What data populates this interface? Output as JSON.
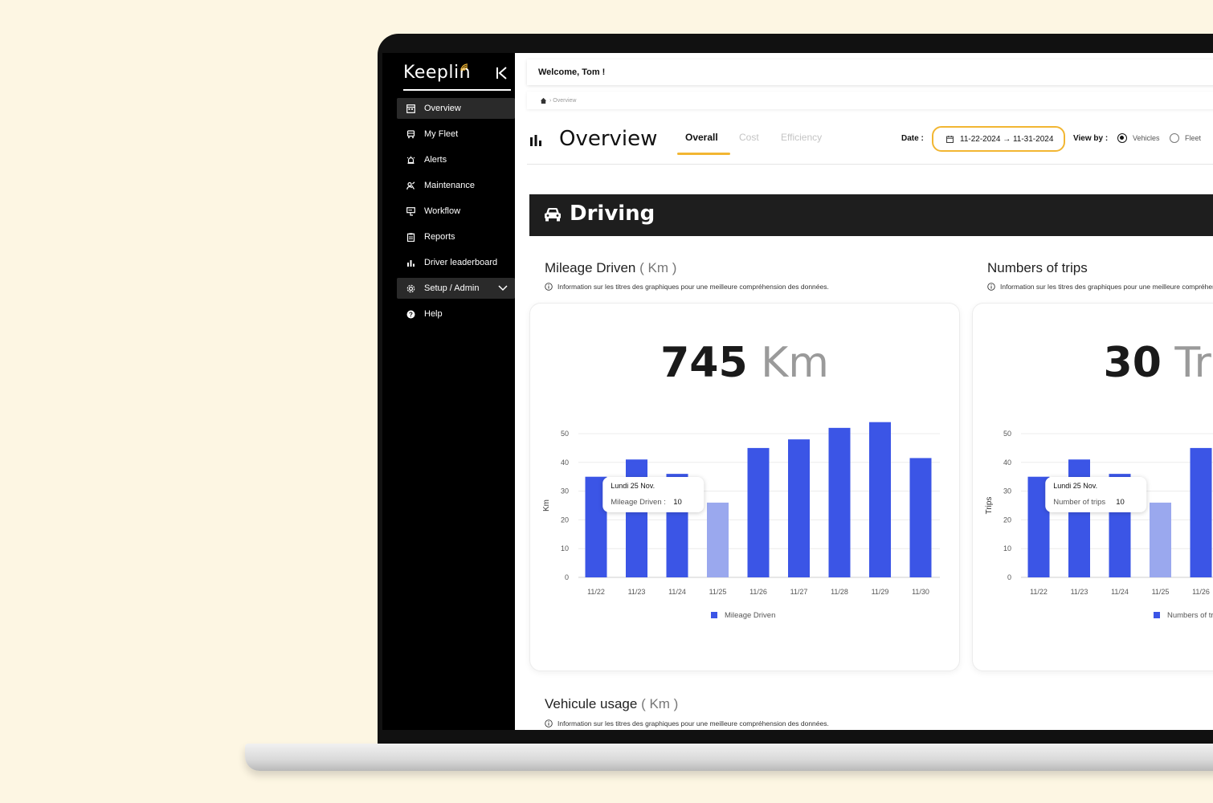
{
  "app": {
    "logo": "Keeplin",
    "accent": "#f2b632",
    "bar_color": "#3b55e6",
    "bar_highlight_color": "#9aa8ee"
  },
  "sidebar": {
    "items": [
      {
        "label": "Overview",
        "icon": "calendar-grid-icon"
      },
      {
        "label": "My Fleet",
        "icon": "truck-icon"
      },
      {
        "label": "Alerts",
        "icon": "alarm-icon"
      },
      {
        "label": "Maintenance",
        "icon": "wrench-icon"
      },
      {
        "label": "Workflow",
        "icon": "workflow-icon"
      },
      {
        "label": "Reports",
        "icon": "clipboard-icon"
      },
      {
        "label": "Driver leaderboard",
        "icon": "bar-chart-icon"
      },
      {
        "label": "Setup / Admin",
        "icon": "gear-icon"
      },
      {
        "label": "Help",
        "icon": "help-icon"
      }
    ]
  },
  "header": {
    "welcome": "Welcome, Tom !"
  },
  "breadcrumb": {
    "current": "› Overview"
  },
  "page": {
    "title": "Overview",
    "tabs": [
      {
        "label": "Overall",
        "active": true
      },
      {
        "label": "Cost",
        "active": false
      },
      {
        "label": "Efficiency",
        "active": false
      }
    ],
    "date_label": "Date :",
    "date_range": "11-22-2024 → 11-31-2024",
    "viewby_label": "View by :",
    "viewby_options": [
      {
        "label": "Vehicles",
        "selected": true
      },
      {
        "label": "Fleet",
        "selected": false
      }
    ]
  },
  "section": {
    "title": "Driving"
  },
  "cards": {
    "mileage": {
      "title": "Mileage Driven",
      "unit": "( Km )",
      "info": "Information sur les titres des graphiques pour une meilleure compréhension des données.",
      "total_value": "745",
      "total_unit": "Km"
    },
    "trips": {
      "title": "Numbers of trips",
      "info": "Information sur les titres des graphiques pour une meilleure compréhension des données.",
      "total_value": "30",
      "total_unit": "Trips"
    },
    "usage": {
      "title": "Vehicule usage",
      "unit": "( Km )",
      "info": "Information sur les titres des graphiques pour une meilleure compréhension des données."
    }
  },
  "chart_data": [
    {
      "type": "bar",
      "title": "Mileage Driven ( Km )",
      "categories": [
        "11/22",
        "11/23",
        "11/24",
        "11/25",
        "11/26",
        "11/27",
        "11/28",
        "11/29",
        "11/30"
      ],
      "series": [
        {
          "name": "Mileage Driven",
          "values": [
            35,
            41,
            36,
            26,
            45,
            48,
            52,
            54,
            41.5
          ]
        }
      ],
      "ylabel": "Km",
      "ylim": [
        0,
        50
      ],
      "yticks": [
        0,
        10,
        20,
        30,
        40,
        50
      ],
      "grid": true,
      "legend": "bottom-center",
      "highlight_category": "11/25",
      "tooltip": {
        "title": "Lundi 25 Nov.",
        "label": "Mileage Driven",
        "sep": ":",
        "value": "10"
      }
    },
    {
      "type": "bar",
      "title": "Numbers of trips",
      "categories": [
        "11/22",
        "11/23",
        "11/24",
        "11/25",
        "11/26"
      ],
      "series": [
        {
          "name": "Numbers of trips",
          "values": [
            35,
            41,
            36,
            26,
            45
          ]
        }
      ],
      "ylabel": "Trips",
      "ylim": [
        0,
        50
      ],
      "yticks": [
        0,
        10,
        20,
        30,
        40,
        50
      ],
      "grid": true,
      "legend": "bottom-center",
      "highlight_category": "11/25",
      "tooltip": {
        "title": "Lundi 25 Nov.",
        "label": "Number of trips",
        "value": "10"
      }
    }
  ]
}
